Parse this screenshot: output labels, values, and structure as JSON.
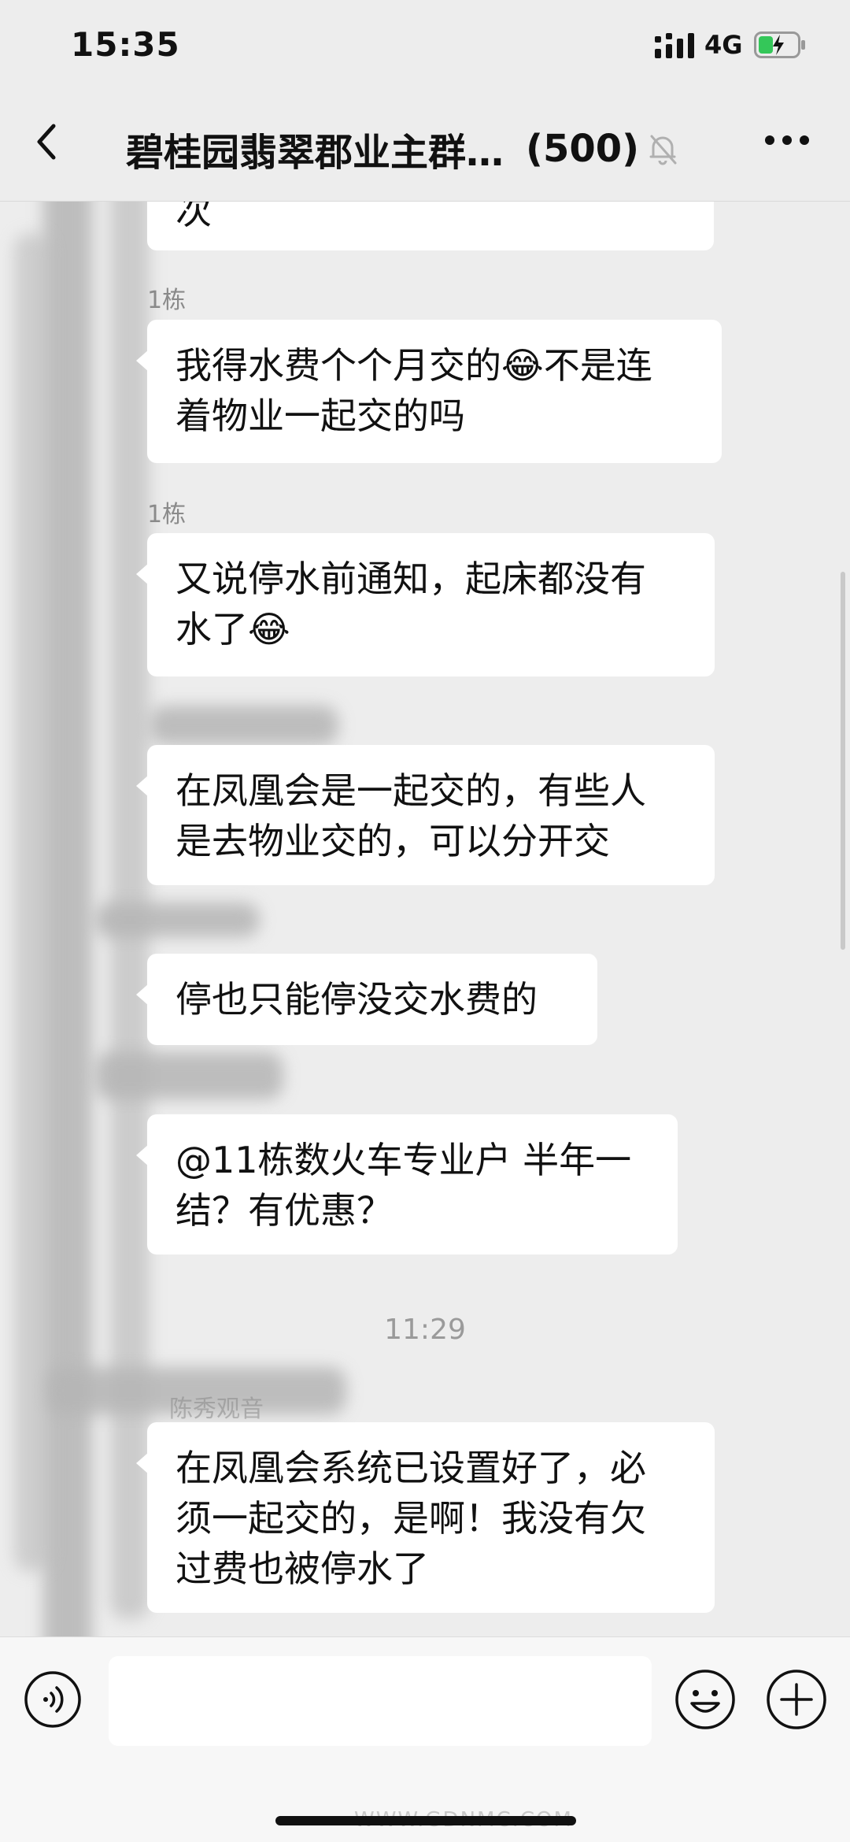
{
  "status_bar": {
    "time": "15:35",
    "network": "4G"
  },
  "header": {
    "title": "碧桂园翡翠郡业主群…",
    "member_count": "(500)"
  },
  "messages": [
    {
      "text": "次"
    },
    {
      "sender": "1栋",
      "text_line1": "我得水费个个月交的😂不是连",
      "text_line2": "着物业一起交的吗"
    },
    {
      "sender": "1栋",
      "text_line1": "又说停水前通知，起床都没有",
      "text_line2": "水了😂"
    },
    {
      "text_line1": "在凤凰会是一起交的，有些人",
      "text_line2": "是去物业交的，可以分开交"
    },
    {
      "text": "停也只能停没交水费的"
    },
    {
      "text_line1": "@11栋数火车专业户 半年一",
      "text_line2": "结？有优惠？"
    },
    {
      "sender": "陈秀观音",
      "text_line1": "在凤凰会系统已设置好了，必",
      "text_line2": "须一起交的，是啊！我没有欠",
      "text_line3": "过费也被停水了"
    }
  ],
  "timestamp": "11:29",
  "watermark": "WWW.GDNMC.COM",
  "icons": {
    "back": "chevron-left-icon",
    "mute": "bell-off-icon",
    "more": "ellipsis-icon",
    "voice": "voice-icon",
    "emoji": "smile-icon",
    "plus": "plus-icon"
  }
}
